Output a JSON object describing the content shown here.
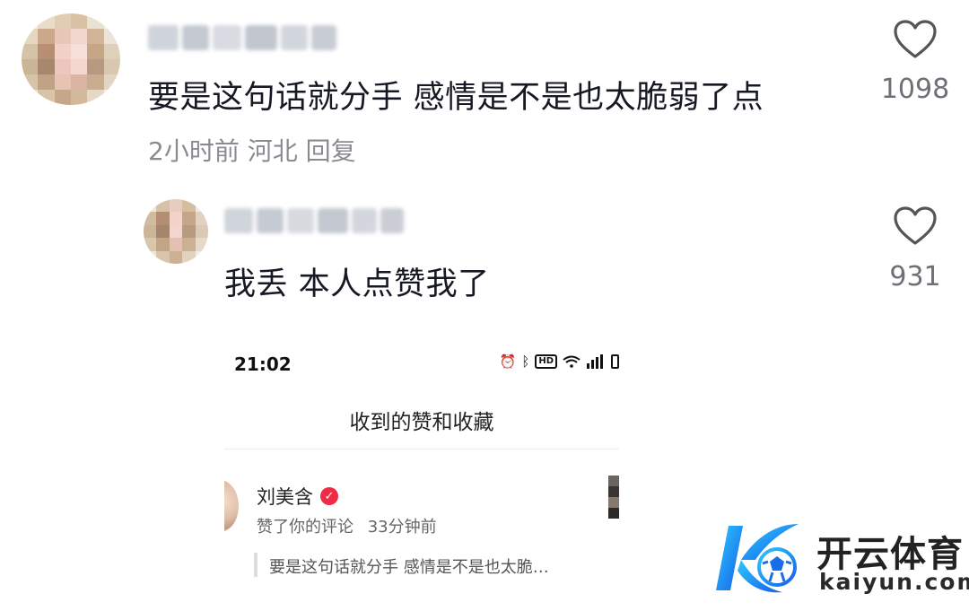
{
  "comments": [
    {
      "text": "要是这句话就分手 感情是不是也太脆弱了点",
      "meta": "2小时前 河北 回复",
      "likes": "1098"
    },
    {
      "text": "我丢 本人点赞我了",
      "likes": "931"
    }
  ],
  "embedded_screenshot": {
    "status_time": "21:02",
    "page_title": "收到的赞和收藏",
    "notification": {
      "user_name": "刘美含",
      "action": "赞了你的评论",
      "time_ago": "33分钟前",
      "quoted_comment": "要是这句话就分手 感情是不是也太脆…"
    }
  },
  "watermark": {
    "brand": "开云体育",
    "url": "kaiyun.com"
  },
  "icons": {
    "like": "heart-outline-icon",
    "verified": "verified-badge-icon",
    "status": [
      "alarm-icon",
      "bluetooth-icon",
      "hd-icon",
      "wifi-icon",
      "signal-icon",
      "battery-icon"
    ]
  },
  "colors": {
    "text_primary": "#161823",
    "text_secondary": "#8a8b91",
    "verified_red": "#ef2b45",
    "watermark_blue": "#1e90ff"
  }
}
